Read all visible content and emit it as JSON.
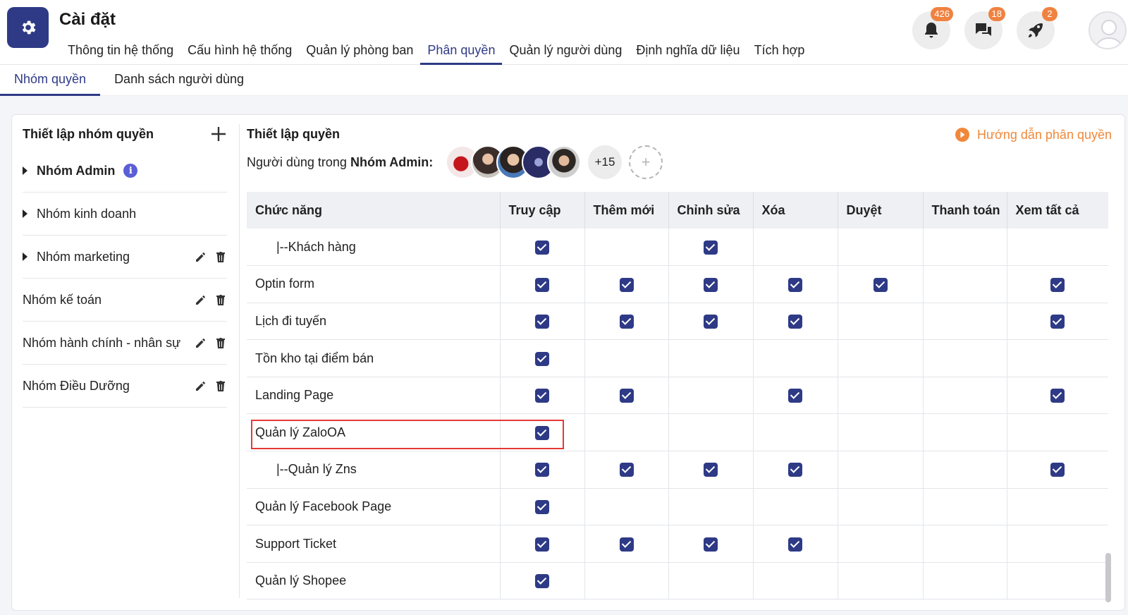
{
  "header": {
    "title": "Cài đặt",
    "logo_icon": "gear-icon",
    "nav": [
      {
        "label": "Thông tin hệ thống",
        "active": false
      },
      {
        "label": "Cấu hình hệ thống",
        "active": false
      },
      {
        "label": "Quản lý phòng ban",
        "active": false
      },
      {
        "label": "Phân quyền",
        "active": true
      },
      {
        "label": "Quản lý người dùng",
        "active": false
      },
      {
        "label": "Định nghĩa dữ liệu",
        "active": false
      },
      {
        "label": "Tích hợp",
        "active": false
      }
    ],
    "notifications": {
      "icon": "bell-icon",
      "count": "426"
    },
    "messages": {
      "icon": "chat-icon",
      "count": "18"
    },
    "updates": {
      "icon": "rocket-icon",
      "count": "2"
    }
  },
  "subnav": {
    "tabs": [
      {
        "label": "Nhóm quyền",
        "active": true
      },
      {
        "label": "Danh sách người dùng",
        "active": false
      }
    ]
  },
  "left": {
    "title": "Thiết lập nhóm quyền",
    "groups": [
      {
        "label": "Nhóm Admin",
        "expandable": true,
        "bold": true,
        "info": true,
        "actions": false
      },
      {
        "label": "Nhóm kinh doanh",
        "expandable": true,
        "bold": false,
        "info": false,
        "actions": false
      },
      {
        "label": "Nhóm marketing",
        "expandable": true,
        "bold": false,
        "info": false,
        "actions": true
      },
      {
        "label": "Nhóm kế toán",
        "expandable": false,
        "bold": false,
        "info": false,
        "actions": true
      },
      {
        "label": "Nhóm hành chính - nhân sự",
        "expandable": false,
        "bold": false,
        "info": false,
        "actions": true
      },
      {
        "label": "Nhóm Điều Dưỡng",
        "expandable": false,
        "bold": false,
        "info": false,
        "actions": true
      }
    ]
  },
  "right": {
    "title": "Thiết lập quyền",
    "guide_link": "Hướng dẫn phân quyền",
    "users_prefix": "Người dùng trong",
    "users_group": "Nhóm Admin:",
    "more_users": "+15",
    "add_user_symbol": "+"
  },
  "table": {
    "columns": [
      "Chức năng",
      "Truy cập",
      "Thêm mới",
      "Chỉnh sửa",
      "Xóa",
      "Duyệt",
      "Thanh toán",
      "Xem tất cả"
    ],
    "rows": [
      {
        "name": "|--Khách hàng",
        "child": true,
        "checks": [
          true,
          false,
          true,
          false,
          false,
          false,
          false
        ]
      },
      {
        "name": "Optin form",
        "child": false,
        "checks": [
          true,
          true,
          true,
          true,
          true,
          false,
          true
        ]
      },
      {
        "name": "Lịch đi tuyến",
        "child": false,
        "checks": [
          true,
          true,
          true,
          true,
          false,
          false,
          true
        ]
      },
      {
        "name": "Tồn kho tại điểm bán",
        "child": false,
        "checks": [
          true,
          false,
          false,
          false,
          false,
          false,
          false
        ]
      },
      {
        "name": "Landing Page",
        "child": false,
        "checks": [
          true,
          true,
          false,
          true,
          false,
          false,
          true
        ]
      },
      {
        "name": "Quản lý ZaloOA",
        "child": false,
        "checks": [
          true,
          false,
          false,
          false,
          false,
          false,
          false
        ]
      },
      {
        "name": "|--Quản lý Zns",
        "child": true,
        "checks": [
          true,
          true,
          true,
          true,
          false,
          false,
          true
        ]
      },
      {
        "name": "Quản lý Facebook Page",
        "child": false,
        "checks": [
          true,
          false,
          false,
          false,
          false,
          false,
          false
        ]
      },
      {
        "name": "Support Ticket",
        "child": false,
        "checks": [
          true,
          true,
          true,
          true,
          false,
          false,
          false
        ]
      },
      {
        "name": "Quản lý Shopee",
        "child": false,
        "checks": [
          true,
          false,
          false,
          false,
          false,
          false,
          false
        ]
      }
    ]
  },
  "colors": {
    "primary": "#2e3a86",
    "accent": "#f0883a",
    "badge": "#f08241",
    "highlight": "#e53935"
  }
}
